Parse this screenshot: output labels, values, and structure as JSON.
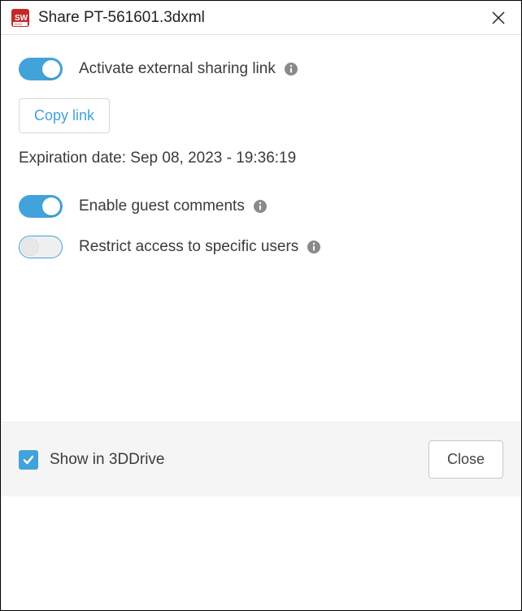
{
  "titlebar": {
    "title": "Share PT-561601.3dxml"
  },
  "options": {
    "activate_label": "Activate external sharing link",
    "copy_link_label": "Copy link",
    "expiration_text": "Expiration date: Sep 08, 2023 - 19:36:19",
    "guest_comments_label": "Enable guest comments",
    "restrict_label": "Restrict access to specific users"
  },
  "footer": {
    "show_label": "Show in 3DDrive",
    "close_label": "Close"
  },
  "toggles": {
    "activate": true,
    "guest_comments": true,
    "restrict": false
  },
  "checkbox": {
    "show_in_3ddrive": true
  }
}
